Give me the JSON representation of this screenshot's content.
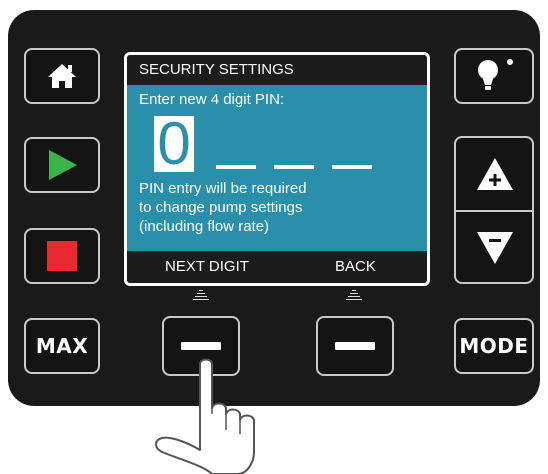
{
  "screen": {
    "title": "SECURITY SETTINGS",
    "prompt": "Enter new 4 digit PIN:",
    "pin": {
      "current_digit": "0",
      "total_digits": 4,
      "active_index": 0
    },
    "note_lines": [
      "PIN entry will be required",
      "to change pump settings",
      "(including flow rate)"
    ],
    "softkeys": {
      "left": "NEXT DIGIT",
      "right": "BACK"
    }
  },
  "buttons": {
    "max_label": "MAX",
    "mode_label": "MODE"
  },
  "colors": {
    "panel": "#1a1a1a",
    "screen_bg": "#2a8fab",
    "play_green": "#3bb54a",
    "stop_red": "#e8292f"
  },
  "icons": [
    "home-icon",
    "play-icon",
    "stop-icon",
    "lightbulb-icon",
    "plus-triangle-icon",
    "minus-triangle-icon",
    "hand-pointer-icon"
  ]
}
